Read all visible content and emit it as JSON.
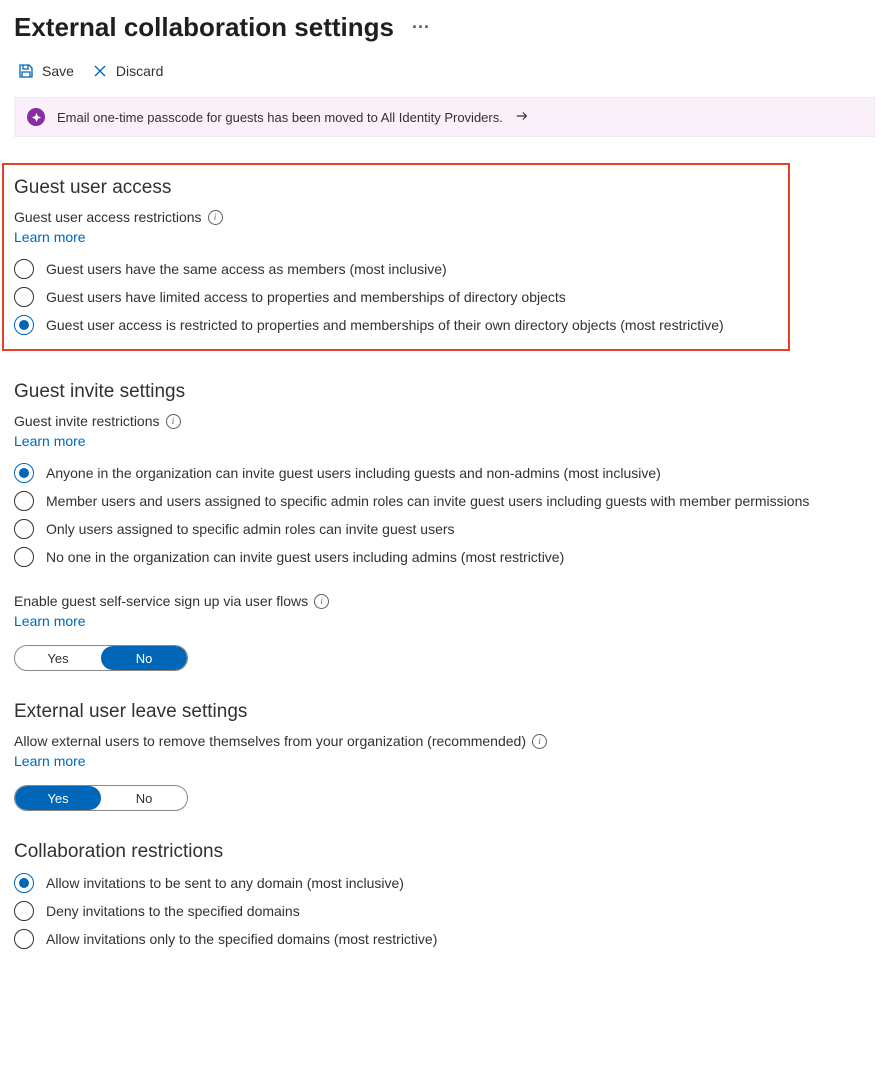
{
  "page": {
    "title": "External collaboration settings"
  },
  "commands": {
    "save": "Save",
    "discard": "Discard"
  },
  "banner": {
    "text": "Email one-time passcode for guests has been moved to All Identity Providers."
  },
  "sections": {
    "guestAccess": {
      "title": "Guest user access",
      "fieldLabel": "Guest user access restrictions",
      "learnMore": "Learn more",
      "options": [
        "Guest users have the same access as members (most inclusive)",
        "Guest users have limited access to properties and memberships of directory objects",
        "Guest user access is restricted to properties and memberships of their own directory objects (most restrictive)"
      ],
      "selectedIndex": 2
    },
    "guestInvite": {
      "title": "Guest invite settings",
      "fieldLabel": "Guest invite restrictions",
      "learnMore": "Learn more",
      "options": [
        "Anyone in the organization can invite guest users including guests and non-admins (most inclusive)",
        "Member users and users assigned to specific admin roles can invite guest users including guests with member permissions",
        "Only users assigned to specific admin roles can invite guest users",
        "No one in the organization can invite guest users including admins (most restrictive)"
      ],
      "selectedIndex": 0,
      "selfService": {
        "label": "Enable guest self-service sign up via user flows",
        "learnMore": "Learn more",
        "yes": "Yes",
        "no": "No",
        "value": "No"
      }
    },
    "externalLeave": {
      "title": "External user leave settings",
      "fieldLabel": "Allow external users to remove themselves from your organization (recommended)",
      "learnMore": "Learn more",
      "yes": "Yes",
      "no": "No",
      "value": "Yes"
    },
    "collab": {
      "title": "Collaboration restrictions",
      "options": [
        "Allow invitations to be sent to any domain (most inclusive)",
        "Deny invitations to the specified domains",
        "Allow invitations only to the specified domains (most restrictive)"
      ],
      "selectedIndex": 0
    }
  }
}
